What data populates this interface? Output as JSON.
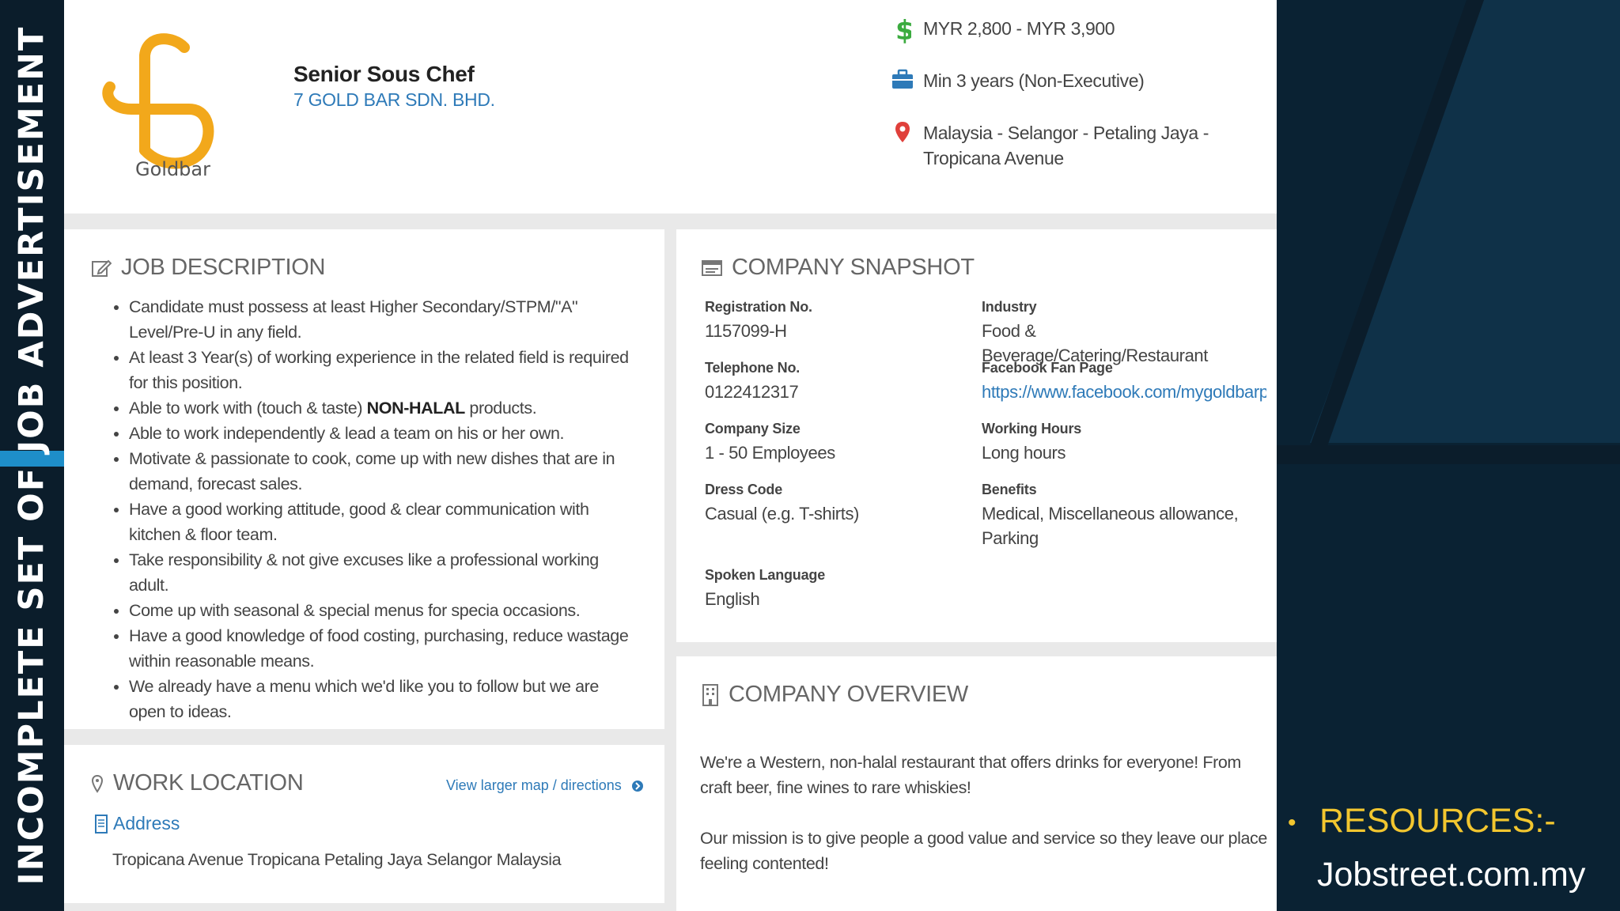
{
  "slide": {
    "vertical_title": "INCOMPLETE SET OF JOB ADVERTISEMENT",
    "resources_label": "RESOURCES:-",
    "resources_source": "Jobstreet.com.my",
    "colors": {
      "banner": "#0b1d2b",
      "accent": "#1e8ec9",
      "resources": "#f2c62f",
      "panel": "#0a2233"
    }
  },
  "header": {
    "logo_text": "Goldbar",
    "job_title": "Senior Sous Chef",
    "company_name": "7 GOLD BAR SDN. BHD.",
    "salary": "MYR 2,800 - MYR 3,900",
    "experience": "Min 3 years (Non-Executive)",
    "location": "Malaysia - Selangor - Petaling Jaya - Tropicana Avenue",
    "icons": [
      "dollar-icon",
      "briefcase-icon",
      "map-pin-icon"
    ]
  },
  "job_description": {
    "title": "JOB DESCRIPTION",
    "items": [
      "Candidate must possess at least Higher Secondary/STPM/\"A\" Level/Pre-U in any field.",
      "At least 3 Year(s) of working experience in the related field is required for this position.",
      "Able to work with (touch & taste) ",
      "Able to work independently & lead a team on his or her own.",
      "Motivate & passionate to cook, come up with new dishes that are in demand, forecast sales.",
      "Have a good working attitude, good & clear communication with kitchen & floor team.",
      "Take responsibility & not give excuses like a professional working adult.",
      "Come up with seasonal & special menus for specia occasions.",
      "Have a good knowledge of food costing, purchasing, reduce wastage within reasonable means.",
      "We already have a menu which we'd like you to follow but we are open to ideas."
    ],
    "item3_bold": "NON-HALAL",
    "item3_tail": " products."
  },
  "company_snapshot": {
    "title": "COMPANY SNAPSHOT",
    "registration_label": "Registration No.",
    "registration_value": "1157099-H",
    "industry_label": "Industry",
    "industry_value": "Food & Beverage/Catering/Restaurant",
    "telephone_label": "Telephone No.",
    "telephone_value": "0122412317",
    "facebook_label": "Facebook Fan Page",
    "facebook_value": "https://www.facebook.com/mygoldbarpj",
    "size_label": "Company Size",
    "size_value": "1 - 50 Employees",
    "hours_label": "Working Hours",
    "hours_value": "Long hours",
    "dress_label": "Dress Code",
    "dress_value": "Casual (e.g. T-shirts)",
    "benefits_label": "Benefits",
    "benefits_value": "Medical, Miscellaneous allowance, Parking",
    "language_label": "Spoken Language",
    "language_value": "English"
  },
  "company_overview": {
    "title": "COMPANY OVERVIEW",
    "p1": "We're a Western, non-halal restaurant that offers drinks for everyone! From craft beer, fine wines to rare whiskies!",
    "p2": "Our mission is to give people a good value and service so they leave our place feeling contented!"
  },
  "work_location": {
    "title": "WORK LOCATION",
    "map_link": "View larger map / directions",
    "address_title": "Address",
    "address_value": "Tropicana Avenue Tropicana Petaling Jaya Selangor Malaysia"
  }
}
